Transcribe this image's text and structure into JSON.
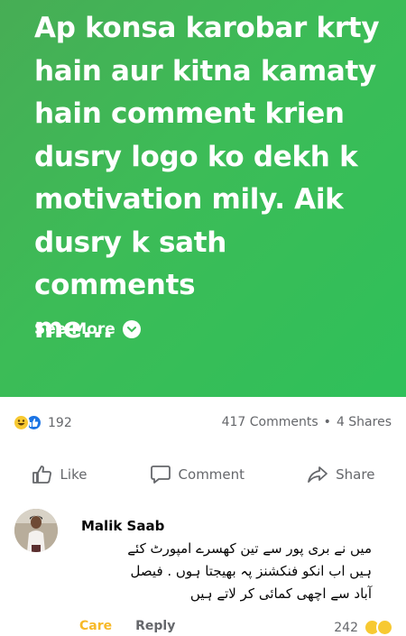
{
  "post": {
    "text": "Ap konsa karobar krty\nhain aur kitna kamaty\nhain comment krien\ndusry logo ko dekh k\nmotivation mily. Aik\ndusry k sath comments\nme...",
    "see_more_label": "See More",
    "background_color": "#3cbc57"
  },
  "reactions": {
    "icons": [
      "haha-icon",
      "like-icon"
    ],
    "count": "192"
  },
  "stats": {
    "comments": "417 Comments",
    "separator": "•",
    "shares": "4 Shares"
  },
  "actions": {
    "like": "Like",
    "comment": "Comment",
    "share": "Share"
  },
  "comment": {
    "author": "Malik Saab",
    "text": "میں نے بری پور سے تین کھسرے امپورٹ کئے\nہیں اب انکو فنکشنز پہ بھیجتا ہوں . فیصل\nآباد سے اچھی کمائی کر لاتے ہیں",
    "care_label": "Care",
    "reply_label": "Reply",
    "reaction_count": "242",
    "care_color": "#f7b928"
  }
}
